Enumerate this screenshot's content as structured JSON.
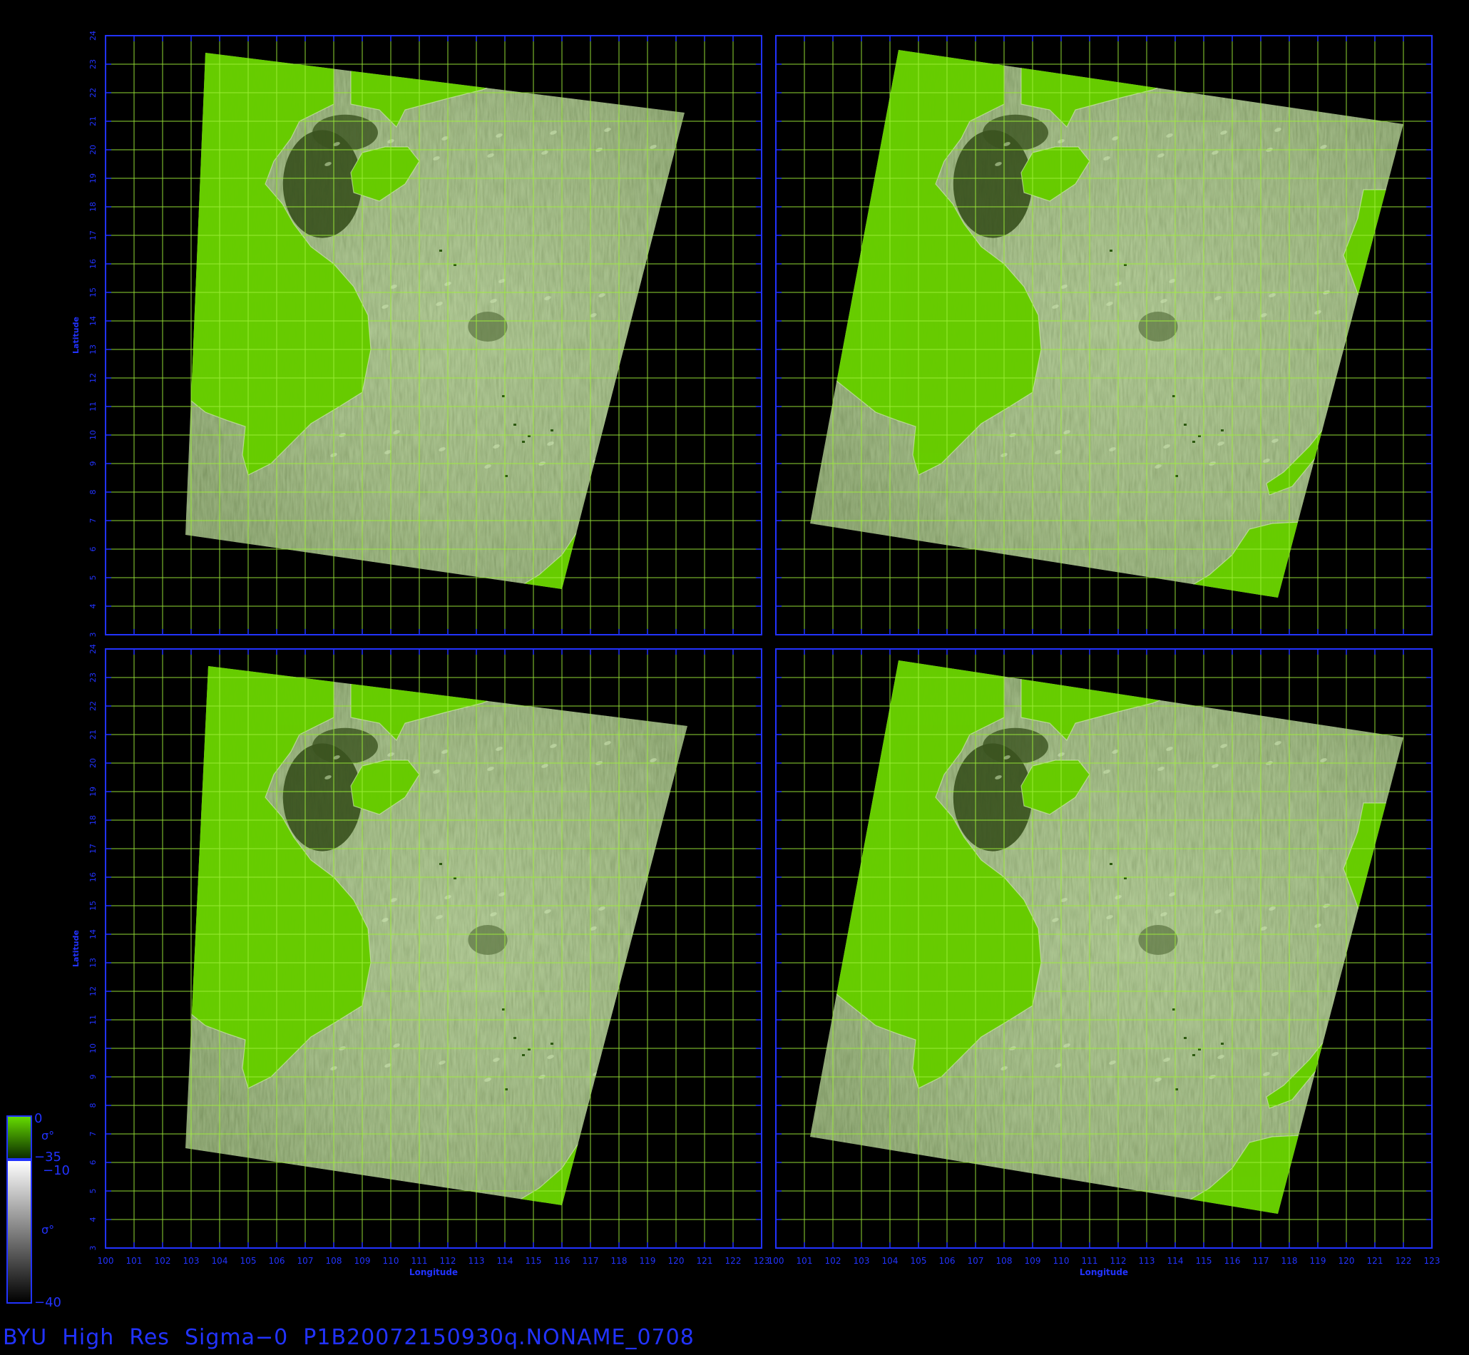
{
  "title": "BYU  High  Res  Sigma−0  P1B20072150930q.NONAME_0708",
  "axes": {
    "x_label": "Longitude",
    "y_label": "Latitude",
    "lon_range": [
      100,
      123
    ],
    "lat_range": [
      3,
      24
    ]
  },
  "panels": [
    {
      "name": "panel-top-left",
      "swath": [
        [
          103.5,
          23.4
        ],
        [
          120.3,
          21.3
        ],
        [
          116.0,
          4.6
        ],
        [
          102.8,
          6.5
        ]
      ]
    },
    {
      "name": "panel-top-right",
      "swath": [
        [
          104.3,
          23.5
        ],
        [
          122.0,
          20.9
        ],
        [
          117.6,
          4.3
        ],
        [
          101.2,
          6.9
        ]
      ]
    },
    {
      "name": "panel-bottom-left",
      "swath": [
        [
          103.6,
          23.4
        ],
        [
          120.4,
          21.3
        ],
        [
          116.0,
          4.5
        ],
        [
          102.8,
          6.5
        ]
      ]
    },
    {
      "name": "panel-bottom-right",
      "swath": [
        [
          104.3,
          23.6
        ],
        [
          122.0,
          20.9
        ],
        [
          117.6,
          4.2
        ],
        [
          101.2,
          6.9
        ]
      ]
    }
  ],
  "colorbar": {
    "land": {
      "max": "0",
      "symbol": "σ°",
      "min": "−35"
    },
    "ocean": {
      "max": "−10",
      "symbol": "σ°",
      "min": "−40"
    }
  },
  "colors": {
    "frame": "#2233ff",
    "grid": "#9ff03a",
    "land": "#66cc00",
    "background": "#000000"
  }
}
